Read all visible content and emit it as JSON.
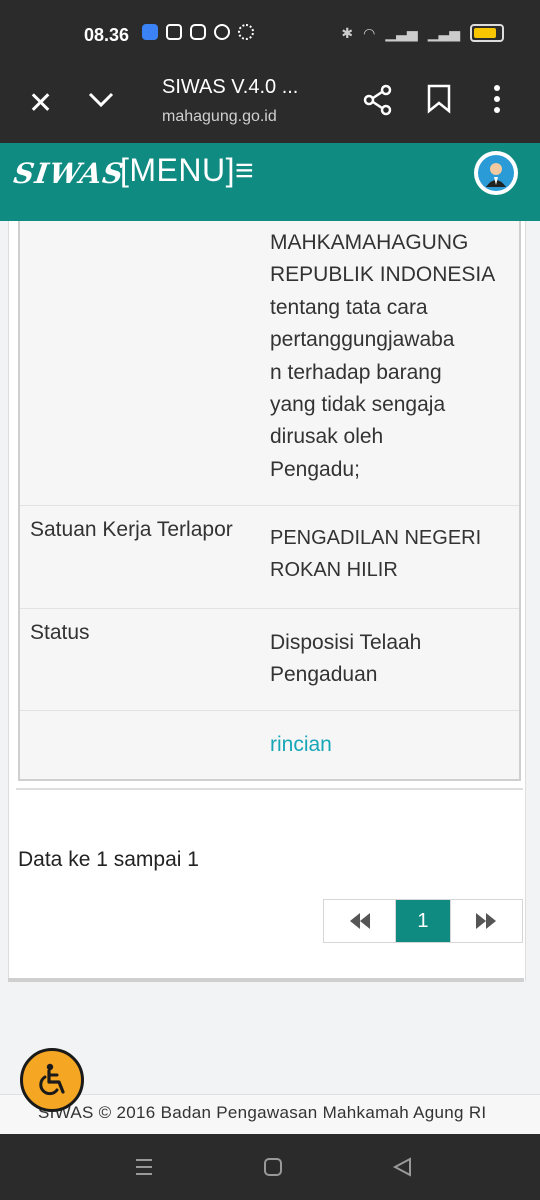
{
  "status_bar": {
    "time": "08.36",
    "battery_level": 0.8,
    "colors": {
      "battery": "#f7c600"
    }
  },
  "browser": {
    "title": "SIWAS V.4.0 ...",
    "url": "mahagung.go.id"
  },
  "app_header": {
    "logo": "SIWAS",
    "menu_label": "[MENU]≡",
    "colors": {
      "primary": "#0f8b82"
    }
  },
  "detail_rows": [
    {
      "label": "",
      "value_lines": [
        "MAHKAMAHAGUNG",
        "REPUBLIK INDONESIA",
        "tentang tata cara",
        "pertanggungjawaba",
        "n terhadap barang",
        "yang tidak sengaja",
        "dirusak oleh",
        "Pengadu;"
      ]
    },
    {
      "label": "Satuan Kerja Terlapor",
      "value_lines": [
        "PENGADILAN NEGERI",
        "ROKAN HILIR"
      ]
    },
    {
      "label": "Status",
      "value_lines": [
        "Disposisi Telaah",
        "Pengaduan"
      ]
    },
    {
      "label": "",
      "link": "rincian"
    }
  ],
  "pagination": {
    "info": "Data ke 1 sampai 1",
    "prev_icon": "double-chevron-left-icon",
    "current_page": "1",
    "next_icon": "double-chevron-right-icon"
  },
  "footer": {
    "text": "SIWAS © 2016 Badan Pengawasan Mahkamah Agung RI"
  },
  "icons": {
    "close": "close-icon",
    "collapse": "chevron-down-icon",
    "share": "share-icon",
    "bookmark": "bookmark-icon",
    "more": "more-vertical-icon",
    "avatar": "user-avatar",
    "accessibility": "accessibility-icon"
  }
}
